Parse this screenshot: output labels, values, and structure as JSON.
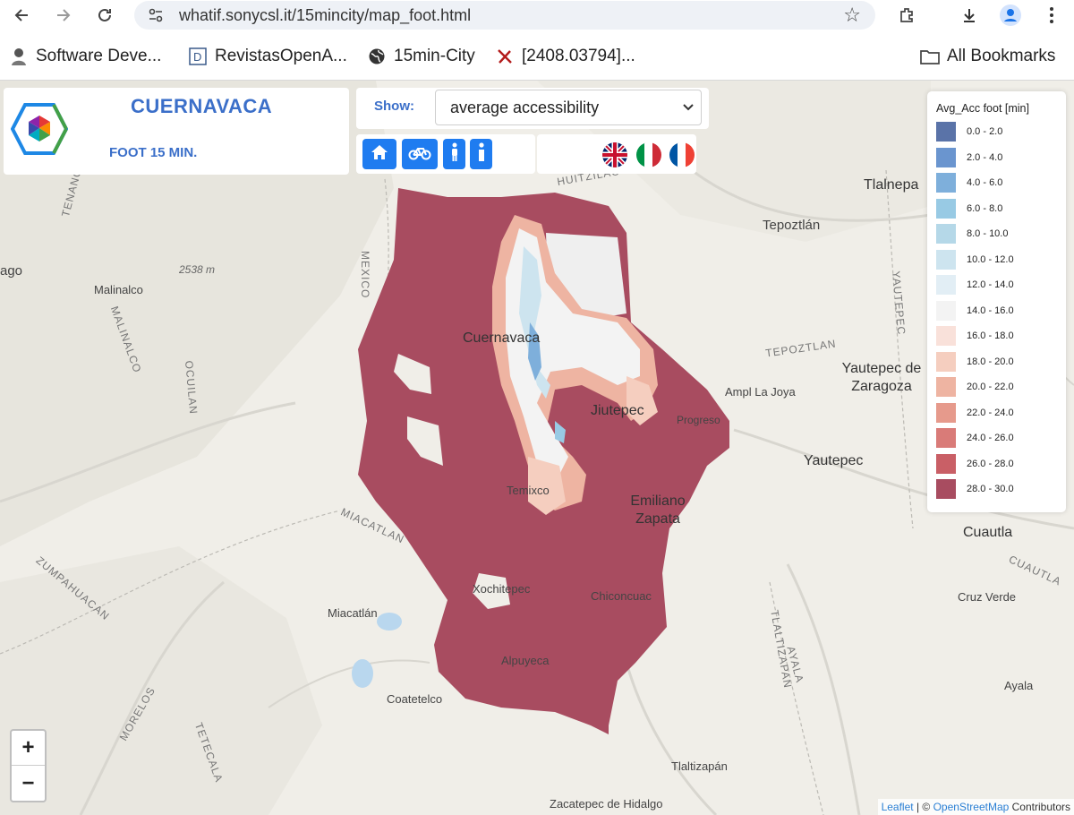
{
  "browser": {
    "url": "whatif.sonycsl.it/15mincity/map_foot.html",
    "bookmarks": [
      {
        "label": "Software Deve...",
        "icon": "person-icon"
      },
      {
        "label": "RevistasOpenA...",
        "icon": "document-d-icon"
      },
      {
        "label": "15min-City",
        "icon": "globe-icon"
      },
      {
        "label": "[2408.03794]...",
        "icon": "arxiv-x-icon"
      }
    ],
    "all_bookmarks": "All Bookmarks"
  },
  "app": {
    "city": "CUERNAVACA",
    "mode": "FOOT 15 MIN.",
    "show_label": "Show:",
    "show_selected": "average accessibility"
  },
  "legend": {
    "title": "Avg_Acc foot [min]",
    "items": [
      {
        "label": "0.0 - 2.0",
        "color": "#5a73a8"
      },
      {
        "label": "2.0 - 4.0",
        "color": "#6a95cf"
      },
      {
        "label": "4.0 - 6.0",
        "color": "#7eafdb"
      },
      {
        "label": "6.0 - 8.0",
        "color": "#98cae4"
      },
      {
        "label": "8.0 - 10.0",
        "color": "#b5d8e8"
      },
      {
        "label": "10.0 - 12.0",
        "color": "#cde4ef"
      },
      {
        "label": "12.0 - 14.0",
        "color": "#e2eef5"
      },
      {
        "label": "14.0 - 16.0",
        "color": "#f3f3f3"
      },
      {
        "label": "16.0 - 18.0",
        "color": "#f9e1da"
      },
      {
        "label": "18.0 - 20.0",
        "color": "#f5cebf"
      },
      {
        "label": "20.0 - 22.0",
        "color": "#eeb4a2"
      },
      {
        "label": "22.0 - 24.0",
        "color": "#e69a8c"
      },
      {
        "label": "24.0 - 26.0",
        "color": "#d97b78"
      },
      {
        "label": "26.0 - 28.0",
        "color": "#c95f66"
      },
      {
        "label": "28.0 - 30.0",
        "color": "#a84c60"
      }
    ]
  },
  "map": {
    "places": [
      {
        "name": "Tlalnepa",
        "cls": "big"
      },
      {
        "name": "Tepoztlán",
        "cls": ""
      },
      {
        "name": "Malinalco",
        "cls": ""
      },
      {
        "name": "Cuernavaca",
        "cls": "big"
      },
      {
        "name": "Jiutepec",
        "cls": "big"
      },
      {
        "name": "Progreso",
        "cls": ""
      },
      {
        "name": "Ampl La Joya",
        "cls": ""
      },
      {
        "name": "Yautepec de Zaragoza",
        "cls": "big"
      },
      {
        "name": "Yautepec",
        "cls": "big"
      },
      {
        "name": "Temixco",
        "cls": ""
      },
      {
        "name": "Emiliano Zapata",
        "cls": "big"
      },
      {
        "name": "Cuautla",
        "cls": "big"
      },
      {
        "name": "Xochitepec",
        "cls": ""
      },
      {
        "name": "Chiconcuac",
        "cls": ""
      },
      {
        "name": "Miacatlán",
        "cls": ""
      },
      {
        "name": "Cruz Verde",
        "cls": ""
      },
      {
        "name": "Alpuyeca",
        "cls": ""
      },
      {
        "name": "Coatetelco",
        "cls": ""
      },
      {
        "name": "Ayala",
        "cls": ""
      },
      {
        "name": "Tlaltizapán",
        "cls": ""
      },
      {
        "name": "Zacatepec de Hidalgo",
        "cls": ""
      },
      {
        "name": "ago",
        "cls": ""
      },
      {
        "name": "2538 m",
        "cls": ""
      },
      {
        "name": "MEXICO",
        "cls": "road"
      },
      {
        "name": "TEPOZTLAN",
        "cls": "road"
      },
      {
        "name": "MIACATLAN",
        "cls": "road"
      },
      {
        "name": "ZUMPAHUACAN",
        "cls": "road"
      },
      {
        "name": "OCUILAN",
        "cls": "road"
      },
      {
        "name": "AYALA",
        "cls": "road"
      },
      {
        "name": "TLALTIZAPAN",
        "cls": "road"
      },
      {
        "name": "MORELOS",
        "cls": "road"
      },
      {
        "name": "TETECALA",
        "cls": "road"
      },
      {
        "name": "CUAUTLA",
        "cls": "road"
      },
      {
        "name": "YAUTEPEC",
        "cls": "road"
      },
      {
        "name": "MALINALCO",
        "cls": "road"
      },
      {
        "name": "TENANCINGO",
        "cls": "road"
      },
      {
        "name": "HUITZILAC",
        "cls": "road"
      }
    ]
  },
  "zoom": {
    "in": "+",
    "out": "−"
  },
  "attribution": {
    "leaflet": "Leaflet",
    "sep": " | © ",
    "osm": "OpenStreetMap",
    "rest": " Contributors"
  }
}
